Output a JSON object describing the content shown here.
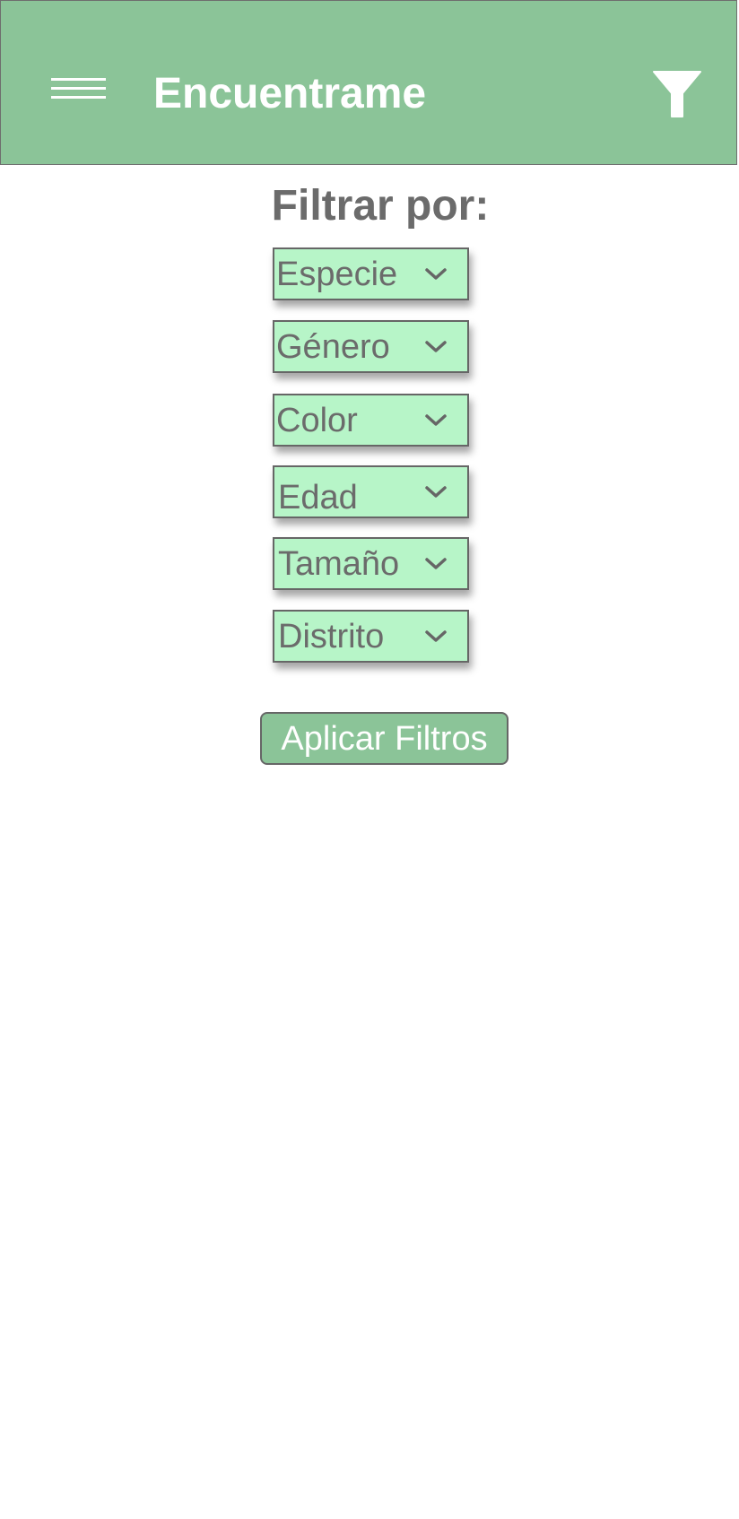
{
  "app": {
    "title": "Encuentrame",
    "menu_icon": "hamburger-menu-icon",
    "filter_icon": "funnel-icon"
  },
  "filters": {
    "heading": "Filtrar por:",
    "dropdowns": [
      {
        "label": "Especie"
      },
      {
        "label": "Género"
      },
      {
        "label": "Color"
      },
      {
        "label": "Edad"
      },
      {
        "label": "Tamaño"
      },
      {
        "label": "Distrito"
      }
    ],
    "apply_label": "Aplicar Filtros"
  },
  "colors": {
    "header_bg": "#8bc498",
    "dropdown_bg": "#b7f5c8",
    "text_gray": "#6b6b6b",
    "border_gray": "#666666"
  }
}
